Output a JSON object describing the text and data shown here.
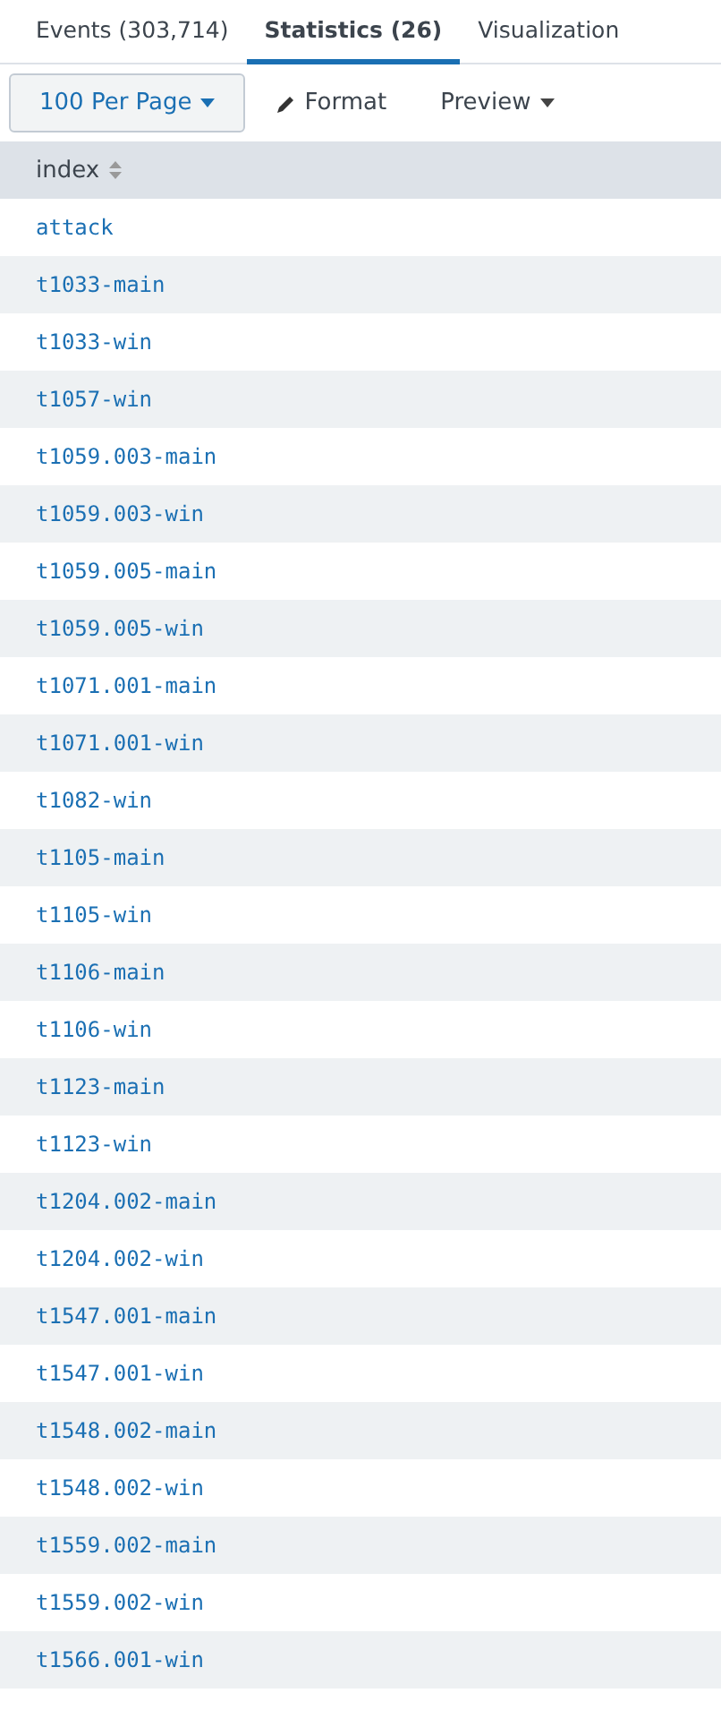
{
  "tabs": [
    {
      "label": "Events (303,714)",
      "selected": false
    },
    {
      "label": "Statistics (26)",
      "selected": true
    },
    {
      "label": "Visualization",
      "selected": false
    }
  ],
  "toolbar": {
    "per_page": "100 Per Page",
    "format": "Format",
    "preview": "Preview"
  },
  "table": {
    "columns": [
      "index"
    ],
    "rows": [
      "attack",
      "t1033-main",
      "t1033-win",
      "t1057-win",
      "t1059.003-main",
      "t1059.003-win",
      "t1059.005-main",
      "t1059.005-win",
      "t1071.001-main",
      "t1071.001-win",
      "t1082-win",
      "t1105-main",
      "t1105-win",
      "t1106-main",
      "t1106-win",
      "t1123-main",
      "t1123-win",
      "t1204.002-main",
      "t1204.002-win",
      "t1547.001-main",
      "t1547.001-win",
      "t1548.002-main",
      "t1548.002-win",
      "t1559.002-main",
      "t1559.002-win",
      "t1566.001-win"
    ]
  }
}
